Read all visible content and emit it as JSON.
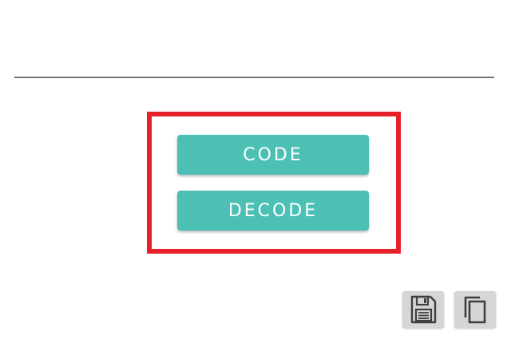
{
  "input": {
    "value": ""
  },
  "actions": {
    "code_label": "CODE",
    "decode_label": "DECODE"
  },
  "toolbar": {
    "save_icon": "save-icon",
    "copy_icon": "copy-icon"
  },
  "colors": {
    "button": "#4dc0b5",
    "highlight": "#e8202a",
    "icon_bg": "#d6d6d6"
  }
}
